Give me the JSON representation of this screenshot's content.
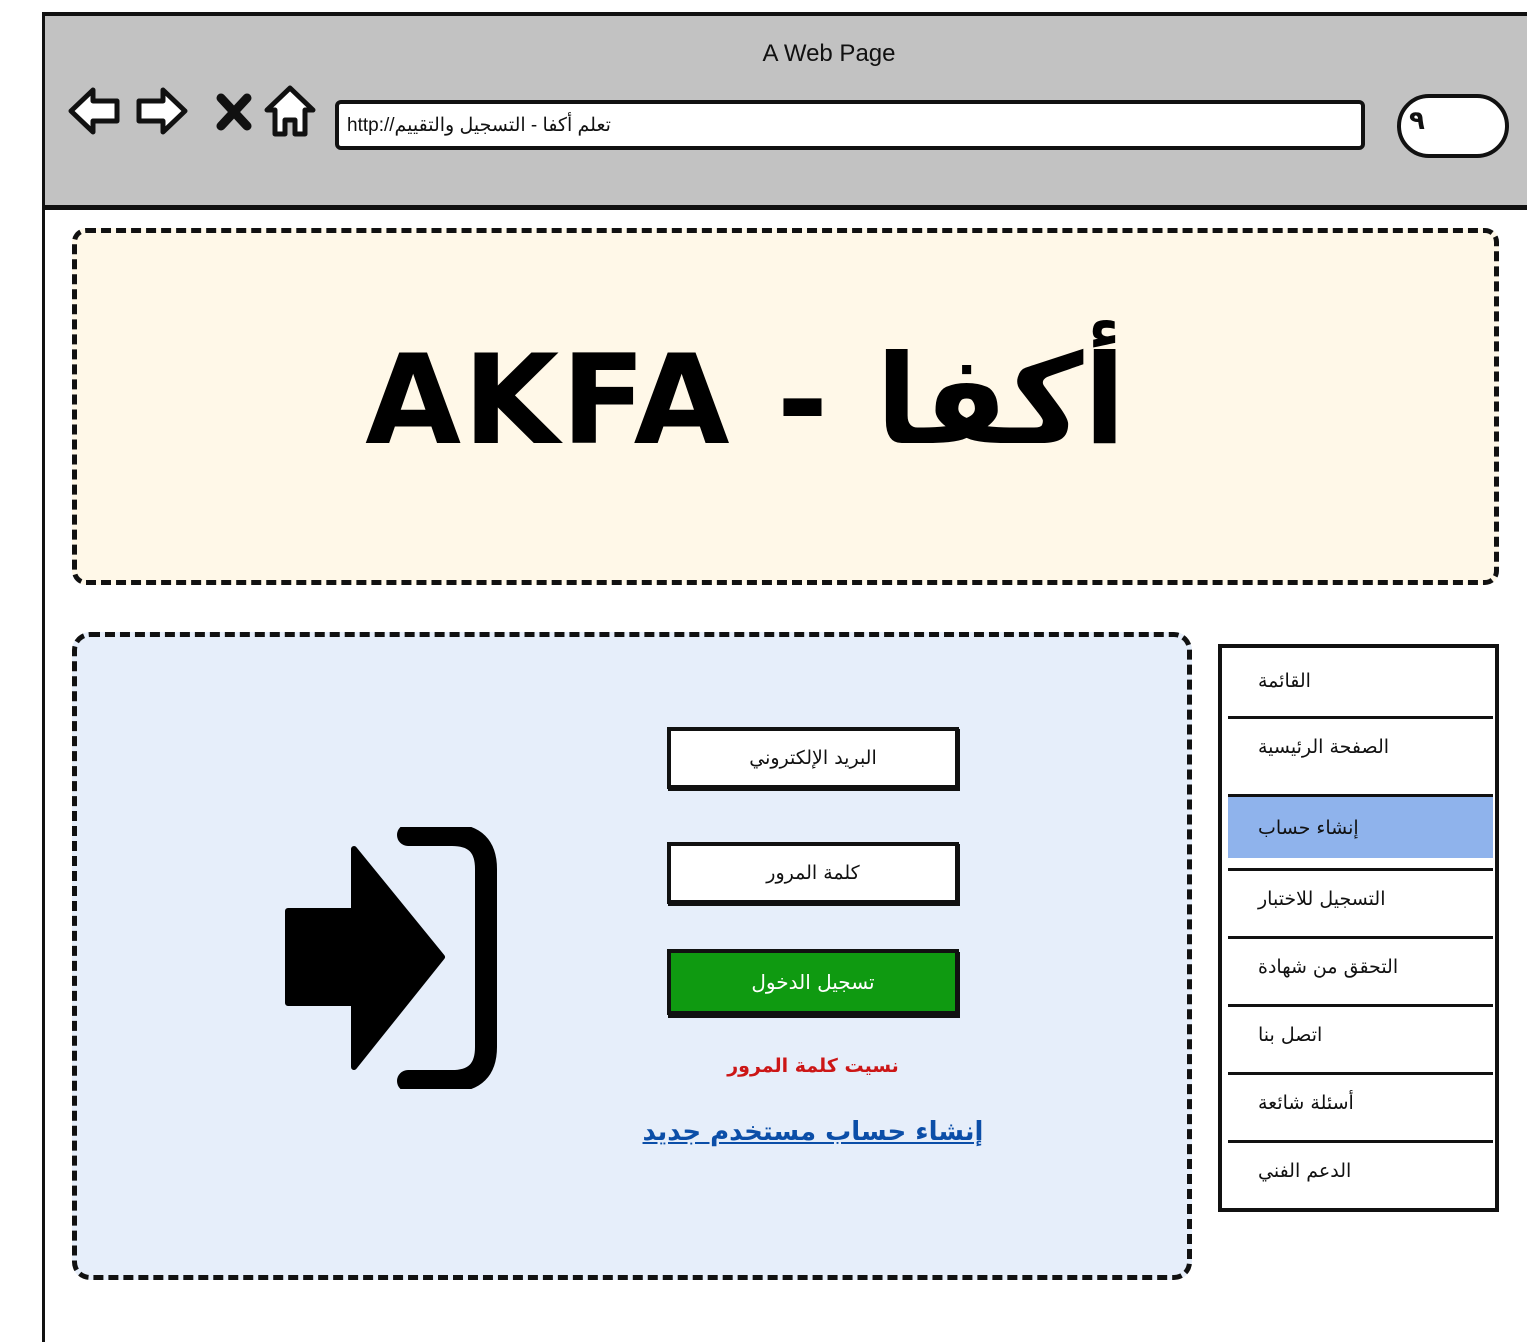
{
  "browser": {
    "window_title": "A Web Page",
    "url": "http://تعلم أكفا - التسجيل والتقييم",
    "search_icon": "search-icon"
  },
  "banner": {
    "title": "AKFA - أكفا",
    "background": "#fff8e8"
  },
  "login": {
    "email_placeholder": "البريد الإلكتروني",
    "password_placeholder": "كلمة المرور",
    "login_button_label": "تسجيل الدخول",
    "forgot_password_label": "نسيت كلمة المرور",
    "create_account_label": "إنشاء حساب مستخدم جديد",
    "login_button_color": "#0f9a11",
    "forgot_color": "#cc1616",
    "create_color": "#0b4ea8",
    "icon": "login-icon"
  },
  "menu": {
    "header": "القائمة",
    "items": [
      {
        "label": "الصفحة الرئيسية",
        "selected": false
      },
      {
        "label": "إنشاء حساب",
        "selected": true
      },
      {
        "label": "التسجيل للاختبار",
        "selected": false
      },
      {
        "label": "التحقق من شهادة",
        "selected": false
      },
      {
        "label": "اتصل بنا",
        "selected": false
      },
      {
        "label": "أسئلة شائعة",
        "selected": false
      },
      {
        "label": "الدعم الفني",
        "selected": false
      }
    ],
    "selected_color": "#8fb3ec"
  }
}
